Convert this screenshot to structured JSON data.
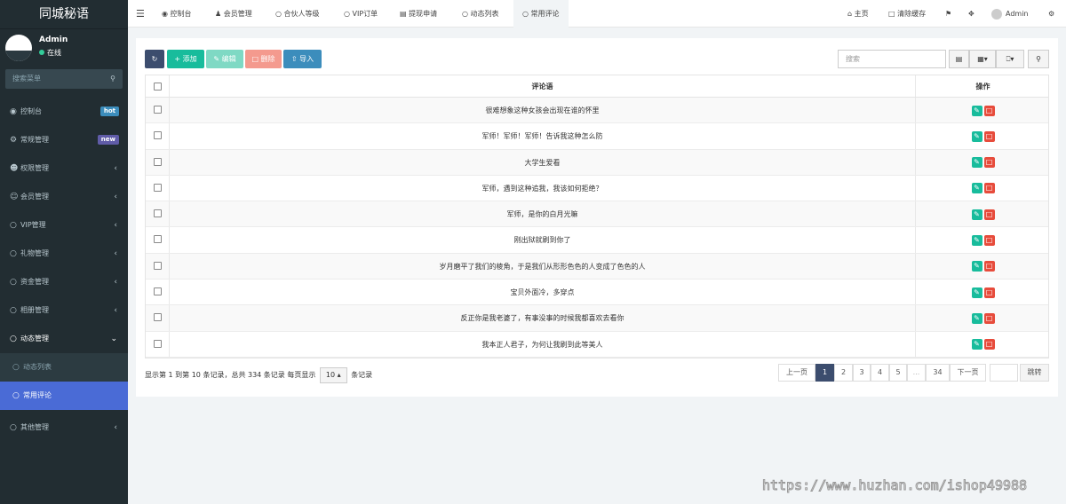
{
  "sidebar": {
    "logo": "同城秘语",
    "user": {
      "name": "Admin",
      "status": "在线"
    },
    "search_placeholder": "搜索菜单",
    "menu": [
      {
        "label": "控制台",
        "badge": "hot",
        "badge_color": "#3c8dbc"
      },
      {
        "label": "常规管理",
        "badge": "new",
        "badge_color": "#605ca8"
      },
      {
        "label": "权限管理"
      },
      {
        "label": "会员管理"
      },
      {
        "label": "VIP管理"
      },
      {
        "label": "礼物管理"
      },
      {
        "label": "资金管理"
      },
      {
        "label": "相册管理"
      },
      {
        "label": "动态管理"
      },
      {
        "label": "动态列表"
      },
      {
        "label": "常用评论"
      },
      {
        "label": "其他管理"
      }
    ]
  },
  "topbar": {
    "tabs": [
      "控制台",
      "会员管理",
      "合伙人等级",
      "VIP订单",
      "提现申请",
      "动态列表",
      "常用评论"
    ],
    "right": {
      "home": "主页",
      "clear_cache": "清除缓存",
      "user": "Admin"
    }
  },
  "toolbar": {
    "add": "添加",
    "edit": "编辑",
    "delete": "删除",
    "import": "导入",
    "search_placeholder": "搜索",
    "colors": {
      "refresh": "#3c4d6e",
      "add": "#18bc9c",
      "edit": "#7fd9c4",
      "delete": "#f49a8e",
      "import": "#3c8dbc"
    }
  },
  "table": {
    "headers": {
      "text": "评论语",
      "op": "操作"
    },
    "rows": [
      "很难想象这种女孩会出现在谁的怀里",
      "军师！军师！军师！告诉我这种怎么防",
      "大学生爱看",
      "军师，遇到这种追我，我该如何拒绝？",
      "军师，是你的白月光嘛",
      "刚出狱就刷到你了",
      "岁月磨平了我们的棱角，于是我们从形形色色的人变成了色色的人",
      "宝贝外面冷，多穿点",
      "反正你是我老婆了，有事没事的时候我都喜欢去看你",
      "我本正人君子，为何让我刷到此等美人"
    ]
  },
  "footer": {
    "info_prefix": "显示第 1 到第 10 条记录，总共 334 条记录 每页显示",
    "page_size": "10",
    "info_suffix": "条记录",
    "prev": "上一页",
    "pages": [
      "1",
      "2",
      "3",
      "4",
      "5",
      "...",
      "34"
    ],
    "next": "下一页",
    "jump": "跳转"
  },
  "watermark": "https://www.huzhan.com/ishop49988"
}
